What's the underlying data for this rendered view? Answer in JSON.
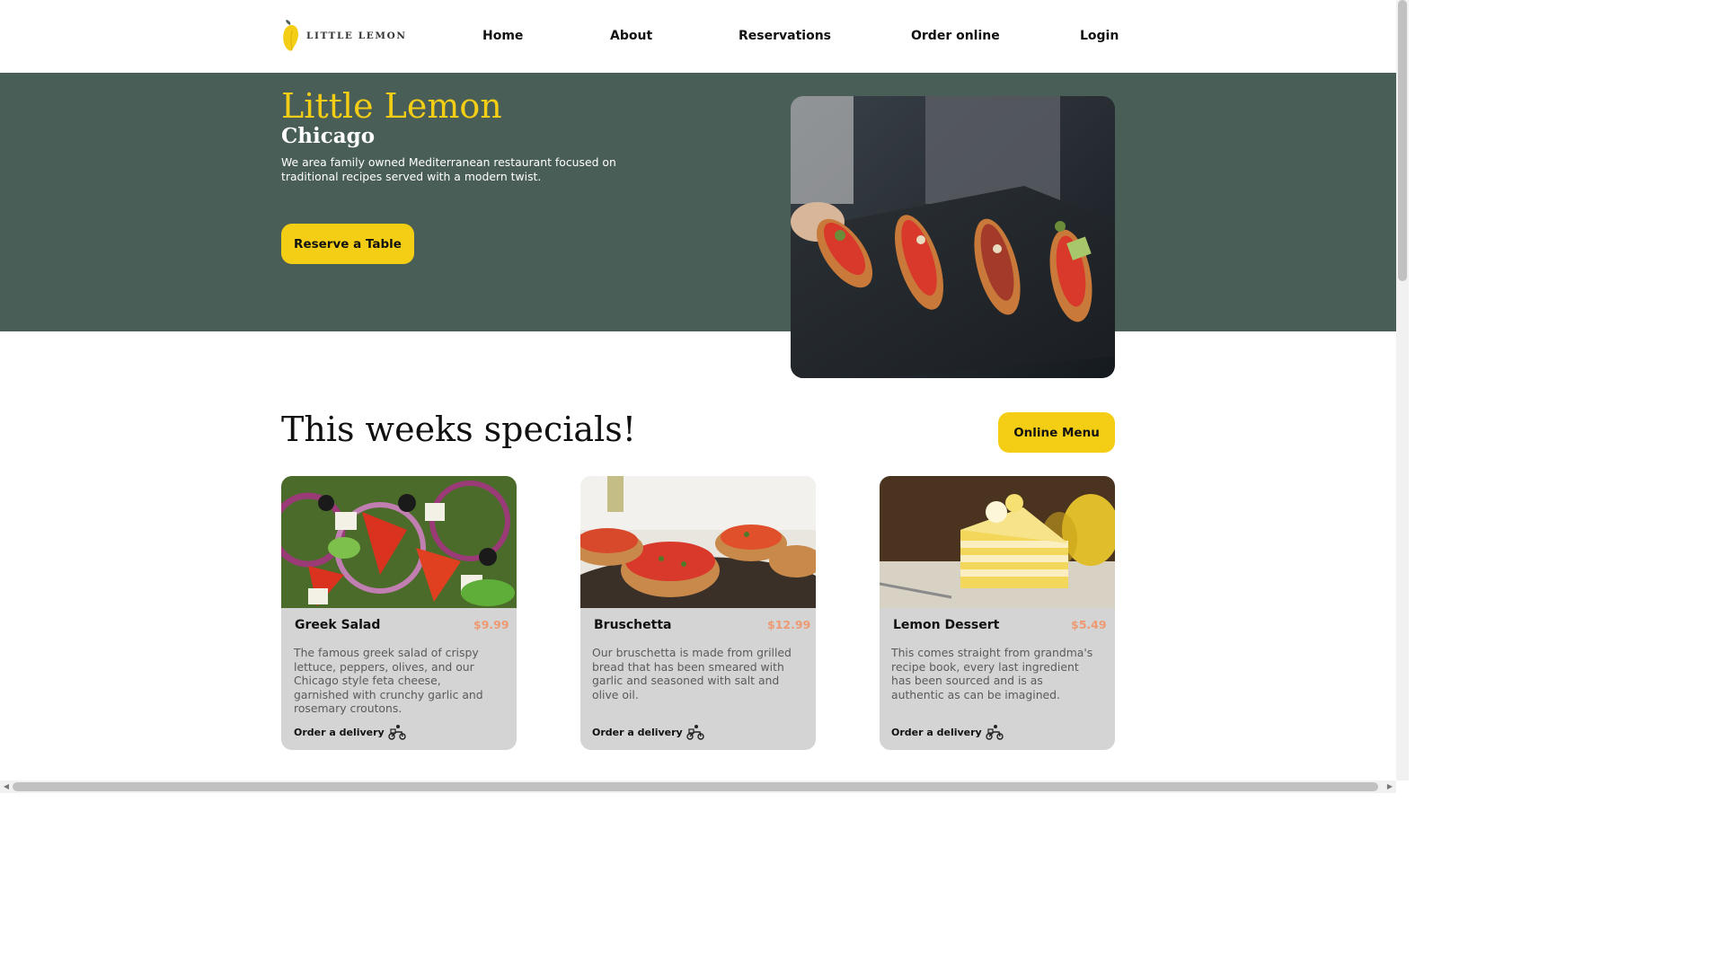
{
  "brand": {
    "name": "LITTLE LEMON"
  },
  "nav": {
    "items": [
      "Home",
      "About",
      "Reservations",
      "Order online",
      "Login"
    ]
  },
  "hero": {
    "title": "Little Lemon",
    "subtitle": "Chicago",
    "description": "We area family owned Mediterranean restaurant focused on traditional recipes served with a modern twist.",
    "cta_label": "Reserve a Table",
    "image": "bruschetta-platter-photo"
  },
  "specials": {
    "heading": "This weeks specials!",
    "menu_button_label": "Online Menu",
    "cards": [
      {
        "name": "Greek Salad",
        "price": "$9.99",
        "description": "The famous greek salad of crispy lettuce, peppers, olives, and our Chicago style feta cheese, garnished with crunchy garlic and rosemary croutons.",
        "order_label": "Order a delivery",
        "image": "greek-salad-photo"
      },
      {
        "name": "Bruschetta",
        "price": "$12.99",
        "description": "Our bruschetta is made from grilled bread that has been smeared with garlic and seasoned with salt and olive oil.",
        "order_label": "Order a delivery",
        "image": "bruschetta-photo"
      },
      {
        "name": "Lemon Dessert",
        "price": "$5.49",
        "description": "This comes straight from grandma's recipe book, every last ingredient has been sourced and is as authentic as can be imagined.",
        "order_label": "Order a delivery",
        "image": "lemon-dessert-photo"
      }
    ]
  },
  "colors": {
    "primary_green": "#495e57",
    "primary_yellow": "#f4ce14",
    "price_salmon": "#ee9972",
    "card_bg": "#d4d4d4"
  },
  "icons": [
    "lemon-logo-icon",
    "scooter-delivery-icon"
  ]
}
